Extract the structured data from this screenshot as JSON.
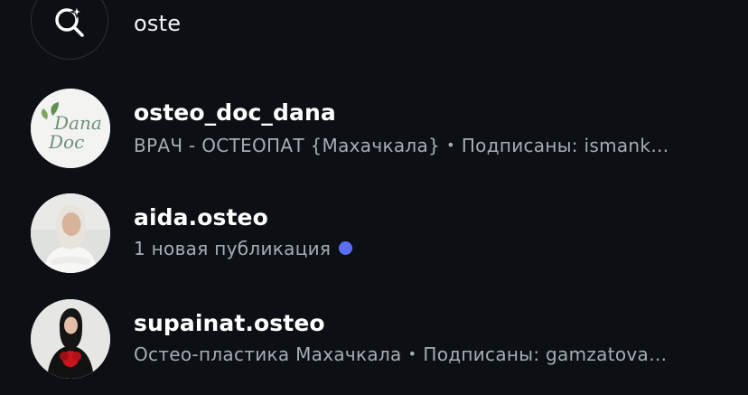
{
  "search": {
    "query": "oste",
    "icon": "ai-search-sparkle-icon"
  },
  "results": [
    {
      "username": "osteo_doc_dana",
      "bio": "ВРАЧ - ОСТЕОПАТ {Махачкала}",
      "followed_by": "Подписаны: ismank…",
      "avatar": "dana-doc-logo",
      "logo_text": {
        "line1": "Dana",
        "line2": "Doc"
      }
    },
    {
      "username": "aida.osteo",
      "status": "1 новая публикация",
      "new_post_dot_color": "#5b6ff2",
      "avatar": "woman-in-white-headscarf-photo"
    },
    {
      "username": "supainat.osteo",
      "bio": "Остео-пластика Махачкала",
      "followed_by": "Подписаны: gamzatova…",
      "avatar": "woman-in-black-with-red-flowers-photo"
    }
  ],
  "separator": "•",
  "colors": {
    "background": "#0c0f14",
    "primary_text": "#ffffff",
    "secondary_text": "#a8adb5",
    "accent_dot": "#5b6ff2"
  }
}
